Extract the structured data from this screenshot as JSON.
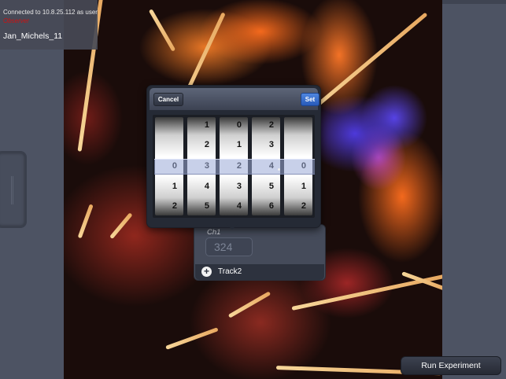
{
  "connection": {
    "status_line": "Connected to 10.8.25.112 as user",
    "warning": "Observer",
    "username": "Jan_Michels_11"
  },
  "picker": {
    "cancel_label": "Cancel",
    "set_label": "Set",
    "wheels": [
      [
        "",
        "",
        "0",
        "1",
        "2"
      ],
      [
        "1",
        "2",
        "3",
        "4",
        "5"
      ],
      [
        "0",
        "1",
        "2",
        "3",
        "4"
      ],
      [
        "2",
        "3",
        "4",
        "5",
        "6"
      ],
      [
        "",
        "",
        "0",
        "1",
        "2"
      ]
    ],
    "selected": [
      "0",
      "3",
      "2",
      "4",
      "0"
    ]
  },
  "track": {
    "channel_label": "Ch1",
    "channel_value": "324",
    "add_track_label": "Track2"
  },
  "footer": {
    "run_label": "Run Experiment"
  },
  "colors": {
    "accent": "#2e6cd0",
    "panel": "#4d5363",
    "warning": "#d01010"
  },
  "icons": {
    "add": "plus-icon",
    "handle": "grip-icon"
  }
}
